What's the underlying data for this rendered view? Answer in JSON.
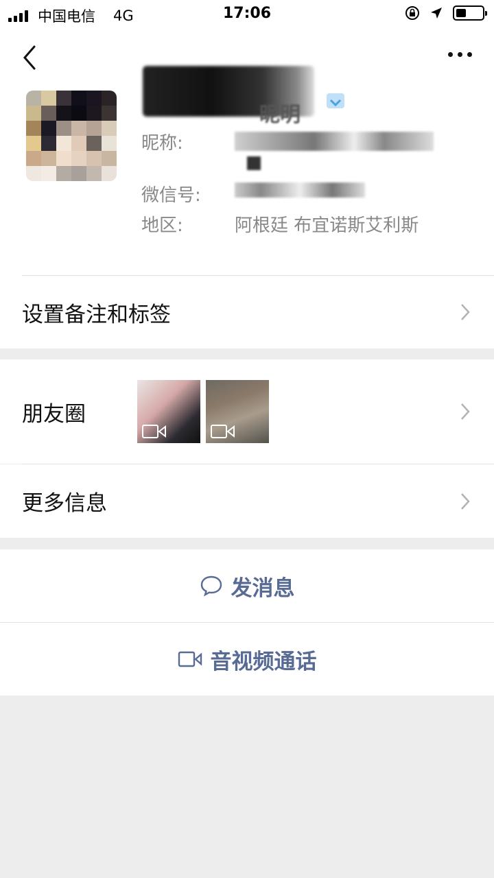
{
  "status_bar": {
    "carrier": "中国电信",
    "network": "4G",
    "time": "17:06",
    "battery_level": 0.4
  },
  "profile": {
    "name_suffix": "昵明",
    "nickname_label": "昵称:",
    "wechat_id_label": "微信号:",
    "region_label": "地区:",
    "region_value": "阿根廷 布宜诺斯艾利斯"
  },
  "menu": {
    "remarks_label": "设置备注和标签",
    "moments_label": "朋友圈",
    "more_info_label": "更多信息"
  },
  "actions": {
    "message_label": "发消息",
    "call_label": "音视频通话"
  },
  "colors": {
    "link": "#576b95",
    "background": "#ededed",
    "divider": "#e2e2e2"
  },
  "icons": [
    "back-icon",
    "more-icon",
    "gender-icon",
    "chevron-right-icon",
    "video-icon",
    "chat-bubble-icon"
  ]
}
